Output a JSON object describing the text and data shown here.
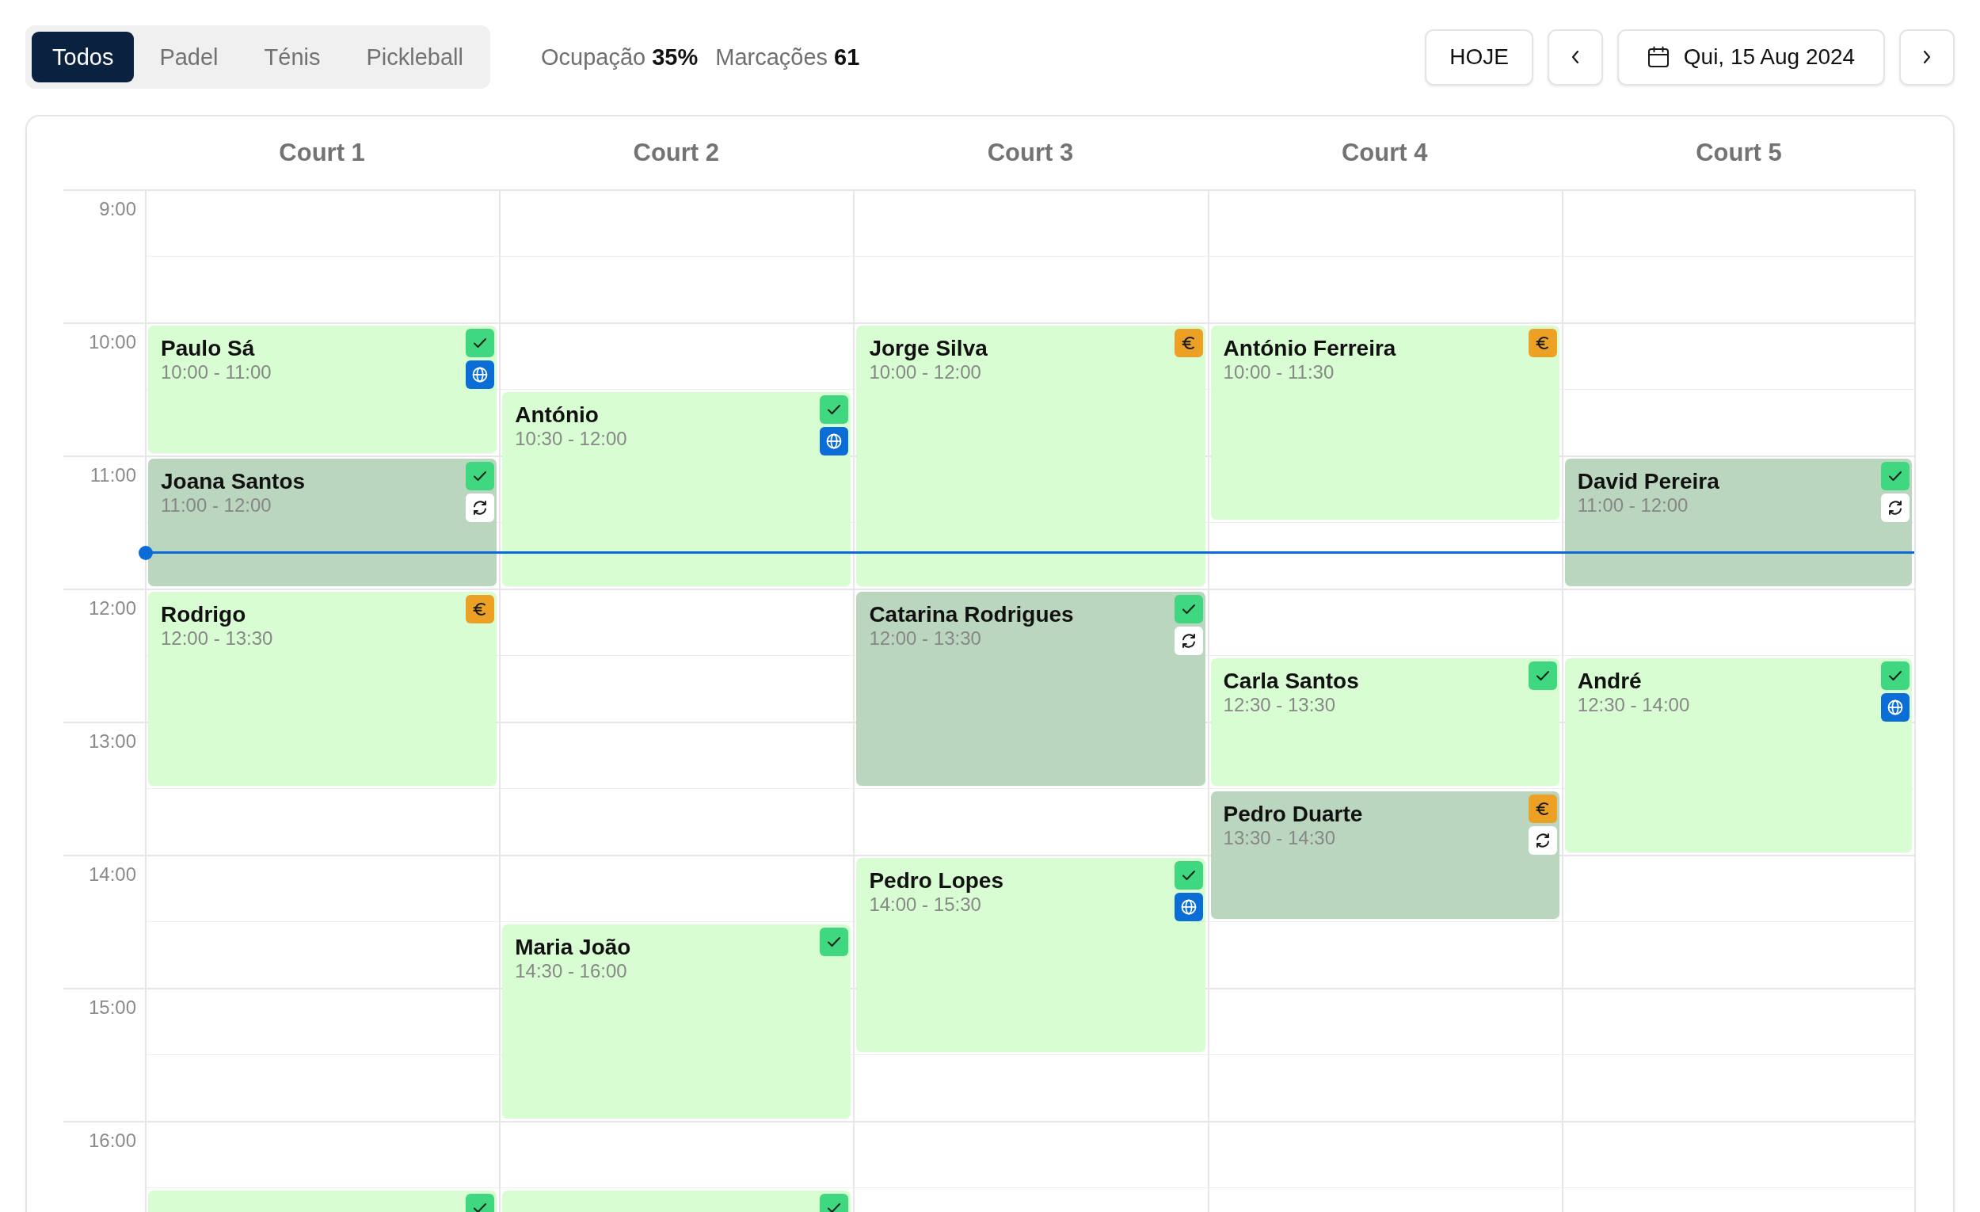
{
  "filters": [
    {
      "label": "Todos",
      "selected": true
    },
    {
      "label": "Padel",
      "selected": false
    },
    {
      "label": "Ténis",
      "selected": false
    },
    {
      "label": "Pickleball",
      "selected": false
    }
  ],
  "stats": [
    {
      "label": "Ocupação",
      "value": "35%"
    },
    {
      "label": "Marcações",
      "value": "61"
    }
  ],
  "toolbar": {
    "today": "HOJE",
    "date": "Qui, 15 Aug 2024"
  },
  "hours": [
    "9:00",
    "10:00",
    "11:00",
    "12:00",
    "13:00",
    "14:00",
    "15:00",
    "16:00"
  ],
  "now_line": {
    "level": 0.61
  },
  "courts": [
    {
      "name": "Court 1",
      "bookings": [
        {
          "kind": "full",
          "name": "Paulo Sá",
          "time": "10:00 - 11:00",
          "color": "#d9fdd3",
          "badges": [
            {
              "kind": "confirmed"
            },
            {
              "kind": "online"
            }
          ]
        },
        {
          "kind": "full",
          "name": "Joana Santos",
          "time": "11:00 - 12:00",
          "color": "#bbd6bf",
          "badges": [
            {
              "kind": "confirmed"
            },
            {
              "kind": "recurring"
            }
          ]
        },
        {
          "kind": "full",
          "name": "Rodrigo",
          "time": "12:00 - 13:30",
          "color": "#d9fdd3",
          "badges": [
            {
              "kind": "unpaid"
            }
          ]
        },
        {
          "kind": "cut",
          "color": "#d9fdd3",
          "badges": [
            {
              "kind": "confirmed"
            }
          ]
        }
      ]
    },
    {
      "name": "Court 2",
      "bookings": [
        {
          "kind": "full",
          "name": "António",
          "time": "10:30 - 12:00",
          "color": "#d9fdd3",
          "badges": [
            {
              "kind": "confirmed"
            },
            {
              "kind": "online"
            }
          ]
        },
        {
          "kind": "full",
          "name": "Maria João",
          "time": "14:30 - 16:00",
          "color": "#d9fdd3",
          "badges": [
            {
              "kind": "confirmed"
            }
          ]
        },
        {
          "kind": "cut",
          "color": "#d9fdd3",
          "badges": [
            {
              "kind": "confirmed"
            }
          ]
        }
      ]
    },
    {
      "name": "Court 3",
      "bookings": [
        {
          "kind": "full",
          "name": "Jorge Silva",
          "time": "10:00 - 12:00",
          "color": "#d9fdd3",
          "badges": [
            {
              "kind": "unpaid"
            }
          ]
        },
        {
          "kind": "full",
          "name": "Catarina Rodrigues",
          "time": "12:00 - 13:30",
          "color": "#bbd6bf",
          "badges": [
            {
              "kind": "confirmed"
            },
            {
              "kind": "recurring"
            }
          ]
        },
        {
          "kind": "full",
          "name": "Pedro Lopes",
          "time": "14:00 - 15:30",
          "color": "#d9fdd3",
          "badges": [
            {
              "kind": "confirmed"
            },
            {
              "kind": "online"
            }
          ]
        }
      ]
    },
    {
      "name": "Court 4",
      "bookings": [
        {
          "kind": "full",
          "name": "António Ferreira",
          "time": "10:00 - 11:30",
          "color": "#d9fdd3",
          "badges": [
            {
              "kind": "unpaid"
            }
          ]
        },
        {
          "kind": "full",
          "name": "Carla Santos",
          "time": "12:30 - 13:30",
          "color": "#d9fdd3",
          "badges": [
            {
              "kind": "confirmed"
            }
          ]
        },
        {
          "kind": "full",
          "name": "Pedro Duarte",
          "time": "13:30 - 14:30",
          "color": "#bbd6bf",
          "badges": [
            {
              "kind": "unpaid"
            },
            {
              "kind": "recurring"
            }
          ]
        }
      ]
    },
    {
      "name": "Court 5",
      "bookings": [
        {
          "kind": "full",
          "name": "David Pereira",
          "time": "11:00 - 12:00",
          "color": "#bbd6bf",
          "badges": [
            {
              "kind": "confirmed"
            },
            {
              "kind": "recurring"
            }
          ]
        },
        {
          "kind": "full",
          "name": "André",
          "time": "12:30 - 14:00",
          "color": "#d9fdd3",
          "badges": [
            {
              "kind": "confirmed"
            },
            {
              "kind": "online"
            }
          ]
        }
      ]
    }
  ]
}
